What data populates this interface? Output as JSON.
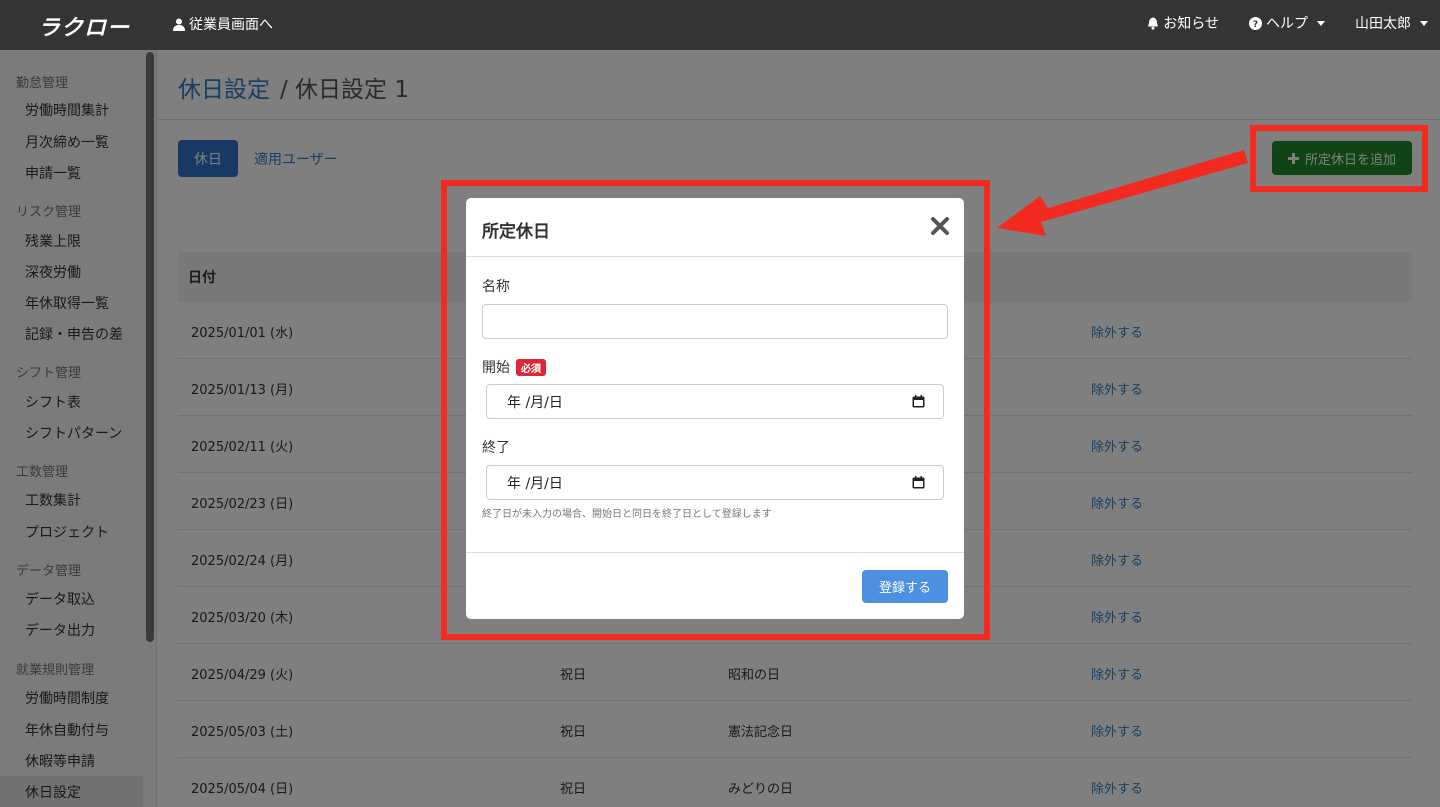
{
  "topnav": {
    "logo": "ラクロー",
    "employee_link": "従業員画面へ",
    "notice": "お知らせ",
    "help": "ヘルプ",
    "user": "山田太郎"
  },
  "sidebar": {
    "sections": [
      {
        "title": "勤怠管理",
        "items": [
          "労働時間集計",
          "月次締め一覧",
          "申請一覧"
        ]
      },
      {
        "title": "リスク管理",
        "items": [
          "残業上限",
          "深夜労働",
          "年休取得一覧",
          "記録・申告の差"
        ]
      },
      {
        "title": "シフト管理",
        "items": [
          "シフト表",
          "シフトパターン"
        ]
      },
      {
        "title": "工数管理",
        "items": [
          "工数集計",
          "プロジェクト"
        ]
      },
      {
        "title": "データ管理",
        "items": [
          "データ取込",
          "データ出力"
        ]
      },
      {
        "title": "就業規則管理",
        "items": [
          "労働時間制度",
          "年休自動付与",
          "休暇等申請",
          "休日設定"
        ]
      }
    ]
  },
  "page": {
    "breadcrumb_link": "休日設定",
    "breadcrumb_current": "/ 休日設定 1",
    "tab_holiday": "休日",
    "tab_users": "適用ユーザー",
    "add_button": "所定休日を追加"
  },
  "table": {
    "header_date": "日付",
    "rows": [
      {
        "date": "2025/01/01 (水)",
        "type": "",
        "name": "",
        "action": "除外する"
      },
      {
        "date": "2025/01/13 (月)",
        "type": "",
        "name": "",
        "action": "除外する"
      },
      {
        "date": "2025/02/11 (火)",
        "type": "",
        "name": "",
        "action": "除外する"
      },
      {
        "date": "2025/02/23 (日)",
        "type": "",
        "name": "",
        "action": "除外する"
      },
      {
        "date": "2025/02/24 (月)",
        "type": "",
        "name": "",
        "action": "除外する"
      },
      {
        "date": "2025/03/20 (木)",
        "type": "",
        "name": "",
        "action": "除外する"
      },
      {
        "date": "2025/04/29 (火)",
        "type": "祝日",
        "name": "昭和の日",
        "action": "除外する"
      },
      {
        "date": "2025/05/03 (土)",
        "type": "祝日",
        "name": "憲法記念日",
        "action": "除外する"
      },
      {
        "date": "2025/05/04 (日)",
        "type": "祝日",
        "name": "みどりの日",
        "action": "除外する"
      }
    ]
  },
  "modal": {
    "title": "所定休日",
    "name_label": "名称",
    "name_value": "",
    "start_label": "開始",
    "required_badge": "必須",
    "start_value": "年 /月/日",
    "end_label": "終了",
    "end_value": "年 /月/日",
    "hint": "終了日が未入力の場合、開始日と同日を終了日として登録します",
    "submit": "登録する"
  },
  "colors": {
    "highlight": "#f22a1f",
    "add_button": "#1f8a2d",
    "submit_button": "#4d8fe0",
    "link": "#2a7ec9"
  }
}
